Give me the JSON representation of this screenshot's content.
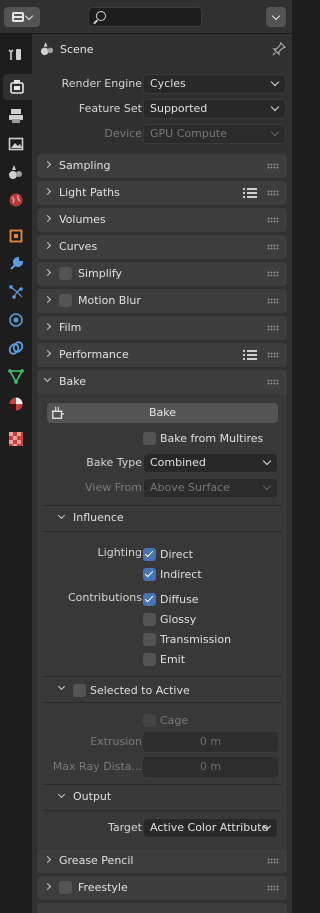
{
  "header": {
    "search_placeholder": ""
  },
  "context": {
    "title": "Scene"
  },
  "render": {
    "engine_label": "Render Engine",
    "engine_value": "Cycles",
    "feature_label": "Feature Set",
    "feature_value": "Supported",
    "device_label": "Device",
    "device_value": "GPU Compute"
  },
  "panels": {
    "sampling": "Sampling",
    "light_paths": "Light Paths",
    "volumes": "Volumes",
    "curves": "Curves",
    "simplify": "Simplify",
    "motion_blur": "Motion Blur",
    "film": "Film",
    "performance": "Performance",
    "bake": "Bake",
    "grease_pencil": "Grease Pencil",
    "freestyle": "Freestyle"
  },
  "bake": {
    "button_label": "Bake",
    "from_multires": "Bake from Multires",
    "type_label": "Bake Type",
    "type_value": "Combined",
    "view_from_label": "View From",
    "view_from_value": "Above Surface",
    "influence": {
      "title": "Influence",
      "lighting_label": "Lighting",
      "direct": "Direct",
      "indirect": "Indirect",
      "contributions_label": "Contributions",
      "diffuse": "Diffuse",
      "glossy": "Glossy",
      "transmission": "Transmission",
      "emit": "Emit"
    },
    "selected_to_active": {
      "title": "Selected to Active",
      "cage": "Cage",
      "extrusion_label": "Extrusion",
      "extrusion_value": "0 m",
      "max_ray_label": "Max Ray Dista...",
      "max_ray_value": "0 m"
    },
    "output": {
      "title": "Output",
      "target_label": "Target",
      "target_value": "Active Color Attribute"
    }
  },
  "colors": {
    "accent_checkbox": "#4772b3",
    "panel_header": "#3d3d3d",
    "editor_bg": "#303030"
  }
}
